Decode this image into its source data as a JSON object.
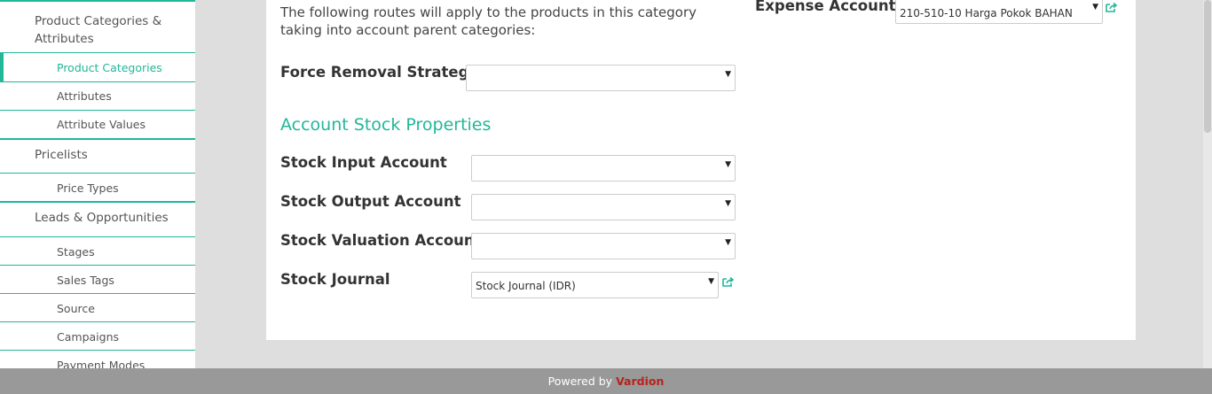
{
  "sidebar": {
    "items": [
      {
        "label": "Product Categories & Attributes",
        "level": 1
      },
      {
        "label": "Product Categories",
        "level": 2,
        "active": true
      },
      {
        "label": "Attributes",
        "level": 2
      },
      {
        "label": "Attribute Values",
        "level": 2
      },
      {
        "label": "Pricelists",
        "level": 1
      },
      {
        "label": "Price Types",
        "level": 2
      },
      {
        "label": "Leads & Opportunities",
        "level": 1
      },
      {
        "label": "Stages",
        "level": 2
      },
      {
        "label": "Sales Tags",
        "level": 2
      },
      {
        "label": "Source",
        "level": 2
      },
      {
        "label": "Campaigns",
        "level": 2
      },
      {
        "label": "Payment Modes",
        "level": 2
      }
    ]
  },
  "form": {
    "intro_text": "The following routes will apply to the products in this category taking into account parent categories:",
    "force_removal_label": "Force Removal Strategy",
    "force_removal_value": "",
    "section_title": "Account Stock Properties",
    "stock_input_label": "Stock Input Account",
    "stock_input_value": "",
    "stock_output_label": "Stock Output Account",
    "stock_output_value": "",
    "stock_valuation_label": "Stock Valuation Account",
    "stock_valuation_value": "",
    "stock_journal_label": "Stock Journal",
    "stock_journal_value": "Stock Journal (IDR)",
    "expense_account_label": "Expense Account",
    "expense_account_value": "210-510-10 Harga Pokok BAHAN"
  },
  "footer": {
    "prefix": "Powered by",
    "brand": "Vardion"
  },
  "icons": {
    "dropdown": "caret-down-icon",
    "external": "external-link-icon"
  },
  "colors": {
    "accent": "#21b799",
    "brand": "#b8221c"
  }
}
